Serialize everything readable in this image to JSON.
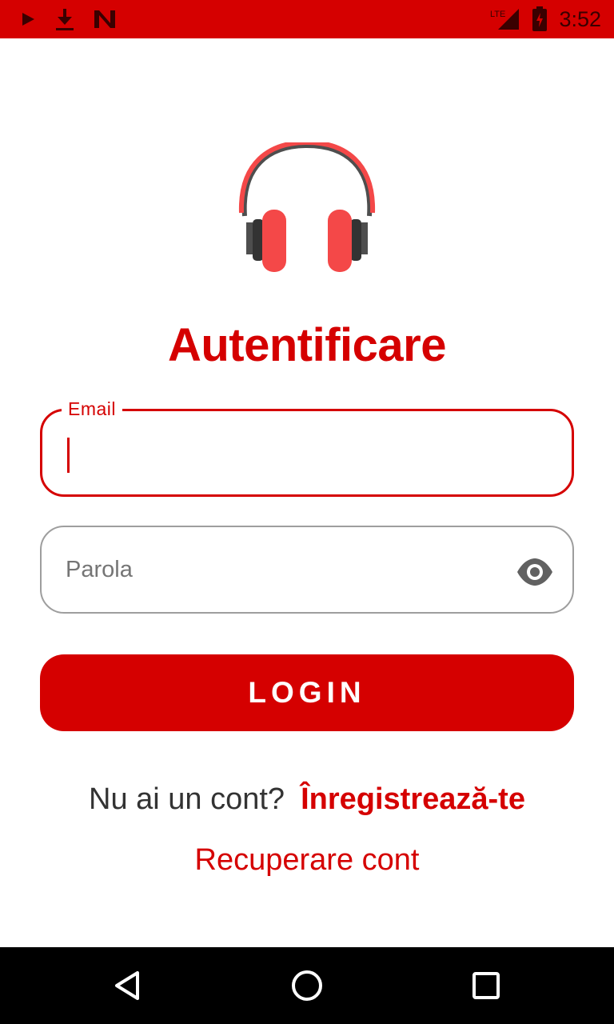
{
  "status_bar": {
    "time": "3:52",
    "network": "LTE",
    "icons": [
      "play-icon",
      "download-icon",
      "n-notification-icon",
      "signal-icon",
      "battery-icon"
    ]
  },
  "login": {
    "title": "Autentificare",
    "email_label": "Email",
    "email_value": "",
    "password_placeholder": "Parola",
    "login_button": "LOGIN",
    "signup_prompt": "Nu ai un cont?",
    "signup_link": "Înregistrează-te",
    "recover_link": "Recuperare cont"
  },
  "colors": {
    "accent": "#d50000",
    "logo_red": "#f44848",
    "logo_dark": "#4e4e4e"
  },
  "nav": {
    "icons": [
      "back-icon",
      "home-icon",
      "recents-icon"
    ]
  }
}
